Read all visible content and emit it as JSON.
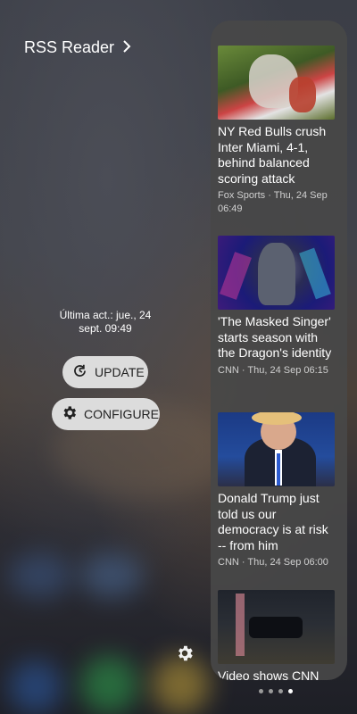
{
  "widget": {
    "title": "RSS Reader",
    "last_update": "Última act.: jue., 24 sept. 09:49",
    "update_label": "UPDATE",
    "configure_label": "CONFIGURE"
  },
  "feed": [
    {
      "headline": "NY Red Bulls crush Inter Miami, 4-1, behind balanced scoring attack",
      "meta": "Fox Sports · Thu, 24 Sep 06:49",
      "thumb_icon": "soccer-match-photo"
    },
    {
      "headline": "'The Masked Singer' starts season with the Dragon's identity",
      "meta": "CNN · Thu, 24 Sep 06:15",
      "thumb_icon": "masked-singer-dragon-photo"
    },
    {
      "headline": "Donald Trump just told us our democracy is at risk -- from him",
      "meta": "CNN · Thu, 24 Sep 06:00",
      "thumb_icon": "press-conference-photo"
    },
    {
      "headline": "Video shows CNN",
      "meta": "",
      "thumb_icon": "night-street-photo"
    }
  ],
  "pager": {
    "count": 4,
    "active_index": 3
  },
  "icons": {
    "chevron": "chevron-right-icon",
    "update": "refresh-icon",
    "configure": "gear-icon",
    "settings": "gear-icon"
  }
}
